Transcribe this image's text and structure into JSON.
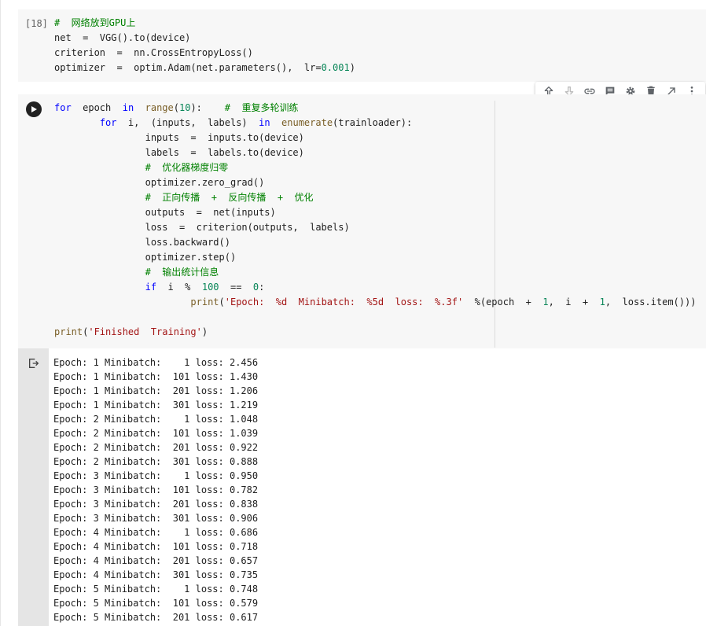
{
  "cell1": {
    "execution_count": "[18]",
    "lines": [
      [
        {
          "t": "#  网络放到GPU上",
          "c": "cm"
        }
      ],
      [
        {
          "t": "net  =  VGG().to(device)",
          "c": ""
        }
      ],
      [
        {
          "t": "criterion  =  nn.CrossEntropyLoss()",
          "c": ""
        }
      ],
      [
        {
          "t": "optimizer  =  optim.Adam(net.parameters(),  lr=",
          "c": ""
        },
        {
          "t": "0.001",
          "c": "nm"
        },
        {
          "t": ")",
          "c": ""
        }
      ]
    ]
  },
  "toolbar": {
    "buttons": [
      {
        "name": "move-up-icon"
      },
      {
        "name": "move-down-icon"
      },
      {
        "name": "link-icon"
      },
      {
        "name": "comment-icon"
      },
      {
        "name": "gear-icon"
      },
      {
        "name": "delete-icon"
      },
      {
        "name": "open-in-new-icon"
      },
      {
        "name": "more-vert-icon"
      }
    ]
  },
  "cell2": {
    "lines": [
      [
        {
          "t": "for",
          "c": "kw"
        },
        {
          "t": "  epoch  ",
          "c": ""
        },
        {
          "t": "in",
          "c": "kw"
        },
        {
          "t": "  ",
          "c": ""
        },
        {
          "t": "range",
          "c": "bi"
        },
        {
          "t": "(",
          "c": ""
        },
        {
          "t": "10",
          "c": "nm"
        },
        {
          "t": "):    ",
          "c": ""
        },
        {
          "t": "#  重复多轮训练",
          "c": "cm"
        }
      ],
      [
        {
          "t": "        ",
          "c": ""
        },
        {
          "t": "for",
          "c": "kw"
        },
        {
          "t": "  i,  (inputs,  labels)  ",
          "c": ""
        },
        {
          "t": "in",
          "c": "kw"
        },
        {
          "t": "  ",
          "c": ""
        },
        {
          "t": "enumerate",
          "c": "bi"
        },
        {
          "t": "(trainloader):",
          "c": ""
        }
      ],
      [
        {
          "t": "                inputs  =  inputs.to(device)",
          "c": ""
        }
      ],
      [
        {
          "t": "                labels  =  labels.to(device)",
          "c": ""
        }
      ],
      [
        {
          "t": "                ",
          "c": ""
        },
        {
          "t": "#  优化器梯度归零",
          "c": "cm"
        }
      ],
      [
        {
          "t": "                optimizer.zero_grad()",
          "c": ""
        }
      ],
      [
        {
          "t": "                ",
          "c": ""
        },
        {
          "t": "#  正向传播  +  反向传播  +  优化",
          "c": "cm"
        }
      ],
      [
        {
          "t": "                outputs  =  net(inputs)",
          "c": ""
        }
      ],
      [
        {
          "t": "                loss  =  criterion(outputs,  labels)",
          "c": ""
        }
      ],
      [
        {
          "t": "                loss.backward()",
          "c": ""
        }
      ],
      [
        {
          "t": "                optimizer.step()",
          "c": ""
        }
      ],
      [
        {
          "t": "                ",
          "c": ""
        },
        {
          "t": "#  输出统计信息",
          "c": "cm"
        }
      ],
      [
        {
          "t": "                ",
          "c": ""
        },
        {
          "t": "if",
          "c": "kw"
        },
        {
          "t": "  i  %  ",
          "c": ""
        },
        {
          "t": "100",
          "c": "nm"
        },
        {
          "t": "  ==  ",
          "c": ""
        },
        {
          "t": "0",
          "c": "nm"
        },
        {
          "t": ":",
          "c": ""
        }
      ],
      [
        {
          "t": "                        ",
          "c": ""
        },
        {
          "t": "print",
          "c": "bi"
        },
        {
          "t": "(",
          "c": ""
        },
        {
          "t": "'Epoch:  %d  Minibatch:  %5d  loss:  %.3f'",
          "c": "st"
        },
        {
          "t": "  %(epoch  +  ",
          "c": ""
        },
        {
          "t": "1",
          "c": "nm"
        },
        {
          "t": ",  i  +  ",
          "c": ""
        },
        {
          "t": "1",
          "c": "nm"
        },
        {
          "t": ",  loss.item()))",
          "c": ""
        }
      ],
      [
        {
          "t": "",
          "c": ""
        }
      ],
      [
        {
          "t": "print",
          "c": "bi"
        },
        {
          "t": "(",
          "c": ""
        },
        {
          "t": "'Finished  Training'",
          "c": "st"
        },
        {
          "t": ")",
          "c": ""
        }
      ]
    ]
  },
  "output": {
    "lines": [
      "Epoch: 1 Minibatch:    1 loss: 2.456",
      "Epoch: 1 Minibatch:  101 loss: 1.430",
      "Epoch: 1 Minibatch:  201 loss: 1.206",
      "Epoch: 1 Minibatch:  301 loss: 1.219",
      "Epoch: 2 Minibatch:    1 loss: 1.048",
      "Epoch: 2 Minibatch:  101 loss: 1.039",
      "Epoch: 2 Minibatch:  201 loss: 0.922",
      "Epoch: 2 Minibatch:  301 loss: 0.888",
      "Epoch: 3 Minibatch:    1 loss: 0.950",
      "Epoch: 3 Minibatch:  101 loss: 0.782",
      "Epoch: 3 Minibatch:  201 loss: 0.838",
      "Epoch: 3 Minibatch:  301 loss: 0.906",
      "Epoch: 4 Minibatch:    1 loss: 0.686",
      "Epoch: 4 Minibatch:  101 loss: 0.718",
      "Epoch: 4 Minibatch:  201 loss: 0.657",
      "Epoch: 4 Minibatch:  301 loss: 0.735",
      "Epoch: 5 Minibatch:    1 loss: 0.748",
      "Epoch: 5 Minibatch:  101 loss: 0.579",
      "Epoch: 5 Minibatch:  201 loss: 0.617"
    ]
  },
  "colors": {
    "cell_bg": "#f7f7f7",
    "gutter_bg": "#e5e5e5",
    "keyword": "#0000ff",
    "builtin": "#795e26",
    "comment": "#008000",
    "string": "#a31515",
    "number": "#098658"
  }
}
